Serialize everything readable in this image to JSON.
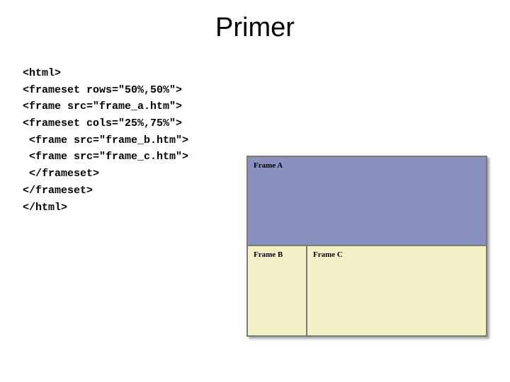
{
  "title": "Primer",
  "code": {
    "l1": "<html>",
    "l2": "<frameset rows=\"50%,50%\">",
    "l3": "<frame src=\"frame_a.htm\">",
    "l4": "<frameset cols=\"25%,75%\">",
    "l5": " <frame src=\"frame_b.htm\">",
    "l6": " <frame src=\"frame_c.htm\">",
    "l7": " </frameset>",
    "l8": "</frameset>",
    "l9": "</html>"
  },
  "frames": {
    "a": "Frame A",
    "b": "Frame B",
    "c": "Frame C"
  }
}
